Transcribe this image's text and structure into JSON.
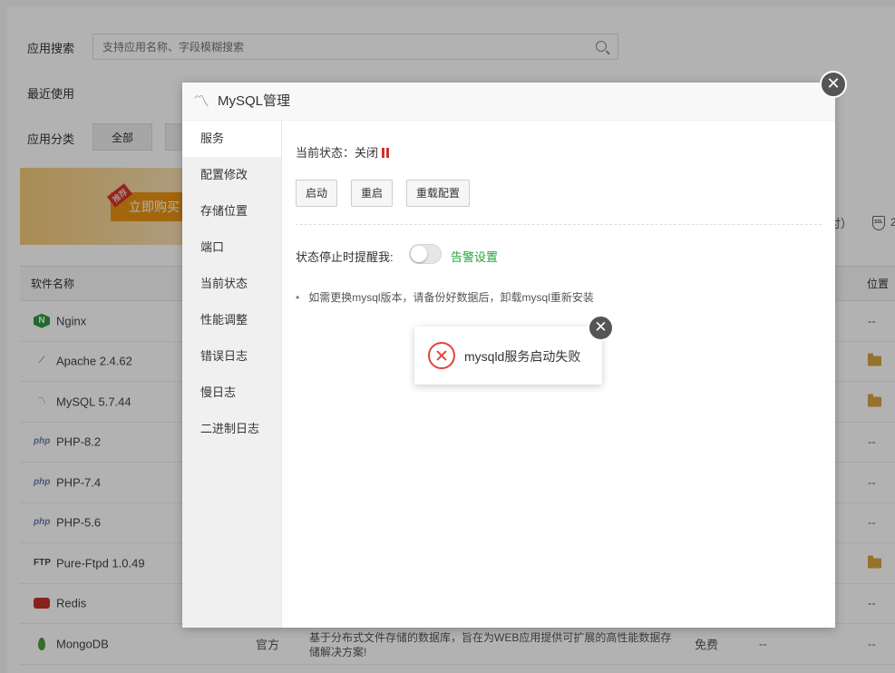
{
  "background": {
    "search_label": "应用搜索",
    "search_placeholder": "支持应用名称、字段模糊搜索",
    "recent_label": "最近使用",
    "category_label": "应用分类",
    "category_all": "全部",
    "banner_buy": "立即购买",
    "banner_tag": "推荐",
    "banner_right_text": "付）",
    "banner_num": "2",
    "ssl_text": "SSL",
    "table_header_name": "软件名称",
    "table_header_position": "位置",
    "rows": [
      {
        "name": "Nginx",
        "icon": "nginx-icon",
        "position": "--"
      },
      {
        "name": "Apache 2.4.62",
        "icon": "apache-icon",
        "position": "folder"
      },
      {
        "name": "MySQL 5.7.44",
        "icon": "mysql-icon",
        "position": "folder"
      },
      {
        "name": "PHP-8.2",
        "icon": "php-icon",
        "position": "--"
      },
      {
        "name": "PHP-7.4",
        "icon": "php-icon",
        "position": "--"
      },
      {
        "name": "PHP-5.6",
        "icon": "php-icon",
        "position": "--"
      },
      {
        "name": "Pure-Ftpd 1.0.49",
        "icon": "ftp-icon",
        "position": "folder"
      },
      {
        "name": "Redis",
        "icon": "redis-icon",
        "position": "--"
      },
      {
        "name": "MongoDB",
        "icon": "mongodb-icon",
        "position": "--",
        "type": "官方",
        "description": "基于分布式文件存储的数据库，旨在为WEB应用提供可扩展的高性能数据存储解决方案!",
        "fee": "免费",
        "extra": "--"
      }
    ]
  },
  "modal": {
    "title": "MySQL管理",
    "close_symbol": "✕",
    "sidebar": [
      "服务",
      "配置修改",
      "存储位置",
      "端口",
      "当前状态",
      "性能调整",
      "错误日志",
      "慢日志",
      "二进制日志"
    ],
    "status_label": "当前状态：关闭",
    "buttons": {
      "start": "启动",
      "restart": "重启",
      "reload": "重载配置"
    },
    "remind_label": "状态停止时提醒我:",
    "alert_link": "告警设置",
    "tip": "如需更换mysql版本，请备份好数据后，卸载mysql重新安装"
  },
  "toast": {
    "message": "mysqld服务启动失败",
    "close_symbol": "✕"
  },
  "colors": {
    "accent_green": "#20a53a",
    "error_red": "#e0443a",
    "buy_orange": "#e99413"
  }
}
